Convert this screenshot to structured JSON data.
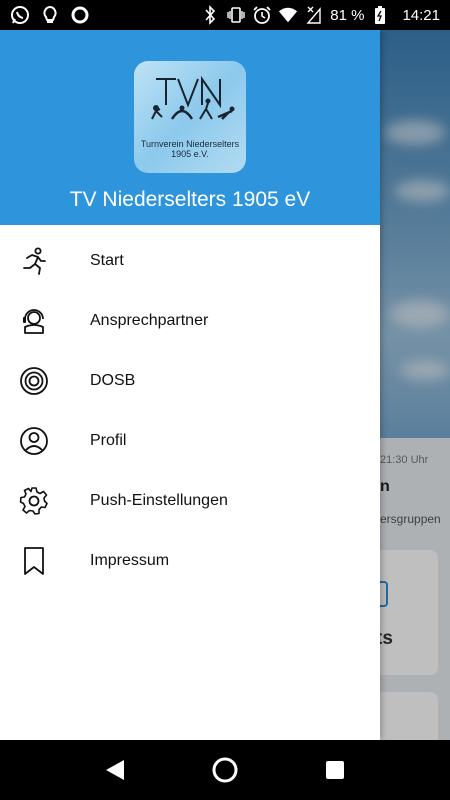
{
  "status_bar": {
    "battery_percent": "81 %",
    "time": "14:21",
    "left_icons": [
      "whatsapp-icon",
      "lightbulb-icon",
      "circle-app-icon"
    ],
    "right_icons": [
      "bluetooth-icon",
      "vibrate-icon",
      "alarm-icon",
      "wifi-icon",
      "signal-icon",
      "battery-icon"
    ]
  },
  "drawer": {
    "logo": {
      "line1": "Turnverein Niederselters",
      "line2": "1905 e.V."
    },
    "title": "TV Niederselters 1905 eV",
    "menu": [
      {
        "label": "Start",
        "icon": "runner-icon"
      },
      {
        "label": "Ansprechpartner",
        "icon": "headset-icon"
      },
      {
        "label": "DOSB",
        "icon": "target-icon"
      },
      {
        "label": "Profil",
        "icon": "user-circle-icon"
      },
      {
        "label": "Push-Einstellungen",
        "icon": "gear-icon"
      },
      {
        "label": "Impressum",
        "icon": "bookmark-icon"
      }
    ]
  },
  "background_app": {
    "time_fragment": "21:30 Uhr",
    "title_fragment": "n",
    "sub_fragment": "ersgruppen",
    "card_fragment": "ts"
  },
  "nav_bar": {
    "buttons": [
      "back-icon",
      "home-icon",
      "recents-icon"
    ]
  },
  "colors": {
    "header_blue": "#2e94dc",
    "accent_blue": "#2b8fd6"
  }
}
